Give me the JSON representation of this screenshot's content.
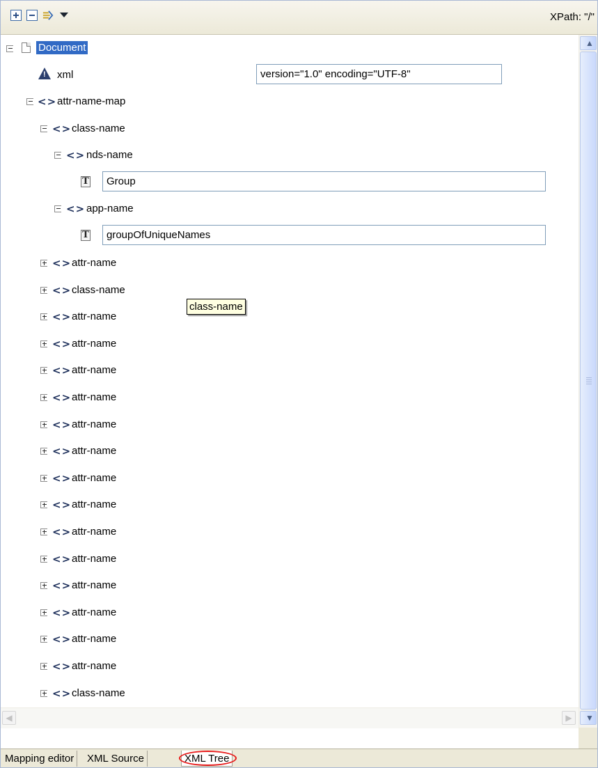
{
  "toolbar": {
    "expand_all_icon": "expand-all-icon",
    "collapse_all_icon": "collapse-all-icon",
    "link_icon": "link-with-editor-icon",
    "menu_icon": "dropdown-menu-icon",
    "xpath_label": "XPath: \"/\""
  },
  "tree": {
    "document_label": "Document",
    "xml_decl": {
      "name": "xml",
      "value": "version=\"1.0\" encoding=\"UTF-8\""
    },
    "root_element": "attr-name-map",
    "class_name": "class-name",
    "nds_name": "nds-name",
    "nds_text": "Group",
    "app_name": "app-name",
    "app_text": "groupOfUniqueNames",
    "collapsed_nodes": [
      "attr-name",
      "class-name",
      "attr-name",
      "attr-name",
      "attr-name",
      "attr-name",
      "attr-name",
      "attr-name",
      "attr-name",
      "attr-name",
      "attr-name",
      "attr-name",
      "attr-name",
      "attr-name",
      "attr-name",
      "attr-name",
      "class-name",
      "attr-name"
    ]
  },
  "tooltip": {
    "text": "class-name"
  },
  "tabs": [
    {
      "label": "Mapping editor",
      "active": false
    },
    {
      "label": "XML Source",
      "active": false
    },
    {
      "label": "XML Tree",
      "active": true
    }
  ]
}
